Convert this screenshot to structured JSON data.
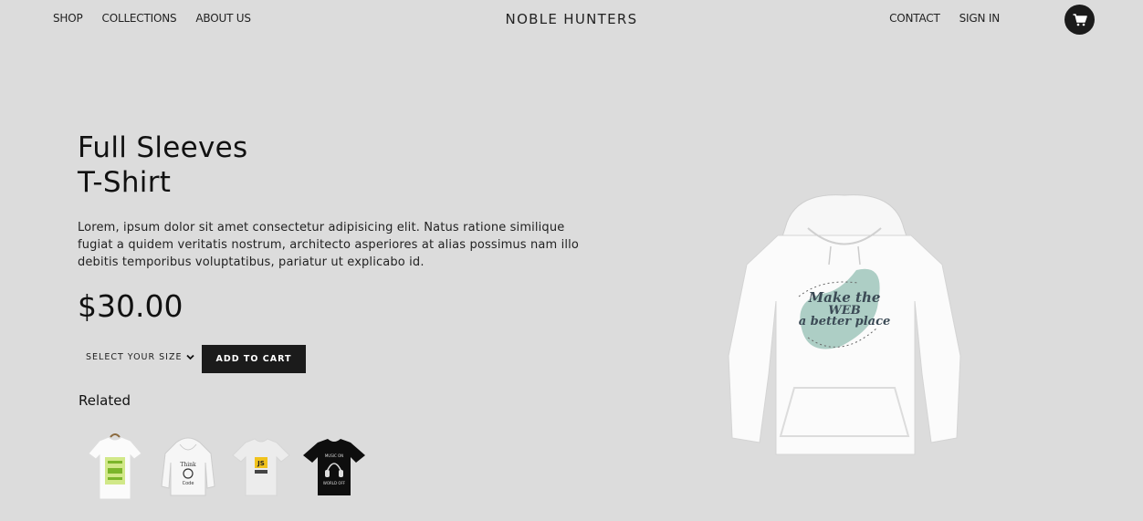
{
  "nav": {
    "left": [
      "SHOP",
      "COLLECTIONS",
      "ABOUT US"
    ],
    "brand": "NOBLE HUNTERS",
    "right": [
      "CONTACT",
      "SIGN IN"
    ],
    "cart_icon": "shopping-cart-icon"
  },
  "product": {
    "title_line1": "Full Sleeves",
    "title_line2": "T-Shirt",
    "description": "Lorem, ipsum dolor sit amet consectetur adipisicing elit. Natus ratione similique fugiat a quidem veritatis nostrum, architecto asperiores at alias possimus nam illo debitis temporibus voluptatibus, pariatur ut explicabo id.",
    "price": "$30.00",
    "size_select": "SELECT YOUR SIZE",
    "add_to_cart": "ADD TO CART",
    "hero_print": [
      "Make the",
      "WEB",
      "a better place"
    ]
  },
  "related": {
    "title": "Related",
    "items": [
      {
        "name": "white-tshirt-green-print",
        "color": "#ffffff"
      },
      {
        "name": "white-hoodie-think-code",
        "color": "#f4f4f4"
      },
      {
        "name": "white-tshirt-js",
        "color": "#f0f0f0"
      },
      {
        "name": "black-tshirt-music",
        "color": "#111111"
      }
    ]
  },
  "colors": {
    "background": "#dcdcdc",
    "dark": "#1b1b1b"
  }
}
